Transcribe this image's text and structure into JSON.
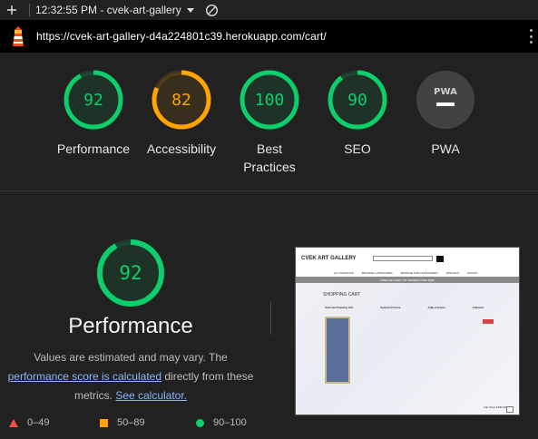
{
  "toolbar": {
    "time_title": "12:32:55 PM - cvek-art-gallery"
  },
  "url": "https://cvek-art-gallery-d4a224801c39.herokuapp.com/cart/",
  "gauges": [
    {
      "label": "Performance",
      "score": "92",
      "value": 92,
      "color": "#0cce6b"
    },
    {
      "label": "Accessibility",
      "score": "82",
      "value": 82,
      "color": "#ffa400"
    },
    {
      "label": "Best Practices",
      "score": "100",
      "value": 100,
      "color": "#0cce6b"
    },
    {
      "label": "SEO",
      "score": "90",
      "value": 90,
      "color": "#0cce6b"
    },
    {
      "label": "PWA",
      "badge": "PWA",
      "color": "#9e9e9e"
    }
  ],
  "main": {
    "score": "92",
    "value": 92,
    "title": "Performance",
    "desc_1": "Values are estimated and may vary. The",
    "link_1": "performance score is calculated",
    "desc_2": "directly from these",
    "desc_3": "metrics.",
    "link_2": "See calculator."
  },
  "legend": {
    "fail": "0–49",
    "average": "50–89",
    "pass": "90–100"
  },
  "thumbnail": {
    "logo": "CVEK ART GALLERY",
    "nav": [
      "ALL PAINTINGS",
      "BROWSE CATEGORIES",
      "BROWSE SUB-CATEGORIES",
      "SPECIALS",
      "GROUP"
    ],
    "promo": "FREE DELIVERY ON ORDERS OVER €999",
    "heading": "SHOPPING CART",
    "columns": [
      "Selected Painting Info",
      "Selected Frame",
      "Adjust Frame",
      "Subtotal"
    ],
    "total": "Cart Total: €180.00"
  },
  "colors": {
    "pass": "#0cce6b",
    "average": "#ffa400",
    "fail": "#ff4e42"
  }
}
